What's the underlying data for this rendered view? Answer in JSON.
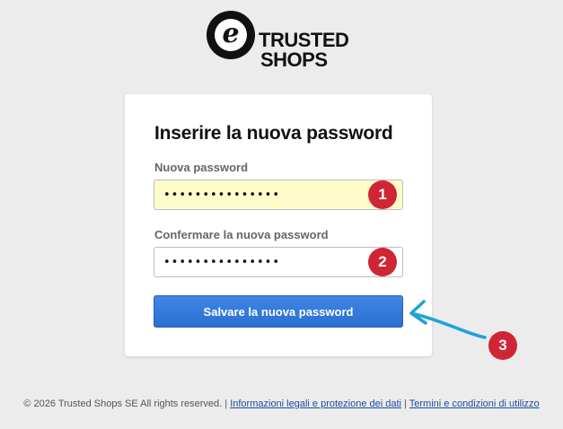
{
  "brand": {
    "logo_letter": "e",
    "line1": "TRUSTED",
    "line2": "SHOPS"
  },
  "form": {
    "title": "Inserire la nuova password",
    "new_password_label": "Nuova password",
    "new_password_value": "•••••••••••••••",
    "confirm_password_label": "Confermare la nuova password",
    "confirm_password_value": "•••••••••••••••",
    "save_label": "Salvare la nuova password"
  },
  "annotations": {
    "step1": "1",
    "step2": "2",
    "step3": "3",
    "badge_color": "#cf2534",
    "arrow_color": "#1fa3d8"
  },
  "footer": {
    "copyright": "© 2026 Trusted Shops SE All rights reserved.",
    "separator": "|",
    "legal_link": "Informazioni legali e protezione dei dati",
    "terms_link": "Termini e condizioni di utilizzo"
  },
  "colors": {
    "background": "#ececec",
    "button": "#2f7be0",
    "autofill": "#fdfbc9"
  }
}
